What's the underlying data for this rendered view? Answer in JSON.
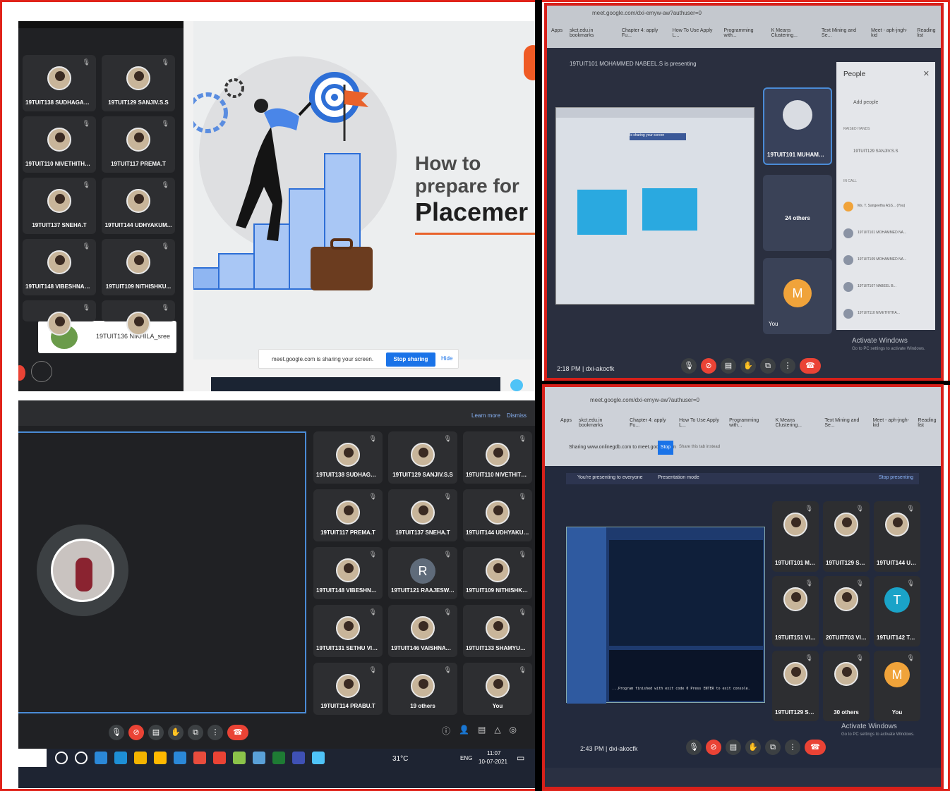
{
  "colors": {
    "border_red": "#e0231a",
    "meet_dark": "#202124",
    "tile": "#2d2e31",
    "accent_blue": "#1a73e8",
    "end_red": "#ea4335"
  },
  "panel1": {
    "tiles": [
      {
        "name": "19TUIT138 SUDHAGAR M"
      },
      {
        "name": "19TUIT129 SANJIV.S.S"
      },
      {
        "name": "19TUIT110 NIVETHITHA..."
      },
      {
        "name": "19TUIT117 PREMA.T"
      },
      {
        "name": "19TUIT137 SNEHA.T"
      },
      {
        "name": "19TUIT144 UDHYAKUM..."
      },
      {
        "name": "19TUIT148 VIBESHNAN.P"
      },
      {
        "name": "19TUIT109 NITHISHKU..."
      }
    ],
    "self_tile_name": "19TUIT136 NIKHILA_sree",
    "slide": {
      "title_line1": "How to",
      "title_line2": "prepare for",
      "title_line3": "Placemer"
    },
    "share_bar": {
      "text": "meet.google.com is sharing your screen.",
      "stop": "Stop sharing",
      "hide": "Hide"
    }
  },
  "panel2": {
    "url": "meet.google.com/dxi-emyw-aw?authuser=0",
    "bookmarks": [
      "Apps",
      "skct.edu.in bookmarks",
      "Chapter 4: apply Fu...",
      "How To Use Apply L...",
      "Programming with...",
      "K Means Clustering...",
      "Text Mining and Se...",
      "Meet - aph-jngh-kid",
      "Reading list"
    ],
    "presenting": "19TUIT101 MOHAMMED NABEEL.S is presenting",
    "speaker_tile": "19TUIT101 MUHAMMED NABEEL.S",
    "others_tile": "24 others",
    "you_tile": "You",
    "you_letter": "M",
    "people_title": "People",
    "add_people": "Add people",
    "raised_hands": "RAISED HANDS",
    "raised_name": "19TUIT129 SANJIV.S.S",
    "in_call": "IN CALL",
    "people_rows": [
      "Ms. T. Sangeetha ASS... (You)",
      "19TUIT101 MOHAMMED NA...",
      "19TUIT109 MOHAMMED NA...",
      "19TUIT107 NABEEL B...",
      "19TUIT110 NIVETHITHA..."
    ],
    "shared_tab": "Is sharing your screen",
    "activate_title": "Activate Windows",
    "activate_sub": "Go to PC settings to activate Windows.",
    "time_code": "2:18 PM | dxi-akocfk"
  },
  "panel3": {
    "top_links": [
      "Learn more",
      "Dismiss"
    ],
    "tiles": [
      {
        "name": "19TUIT138 SUDHAGAR M"
      },
      {
        "name": "19TUIT129 SANJIV.S.S"
      },
      {
        "name": "19TUIT110 NIVETHITHA..."
      },
      {
        "name": "19TUIT117 PREMA.T"
      },
      {
        "name": "19TUIT137 SNEHA.T"
      },
      {
        "name": "19TUIT144 UDHYAKUM..."
      },
      {
        "name": "19TUIT148 VIBESHNAN.P"
      },
      {
        "name": "19TUIT121 RAAJESWAR..."
      },
      {
        "name": "19TUIT109 NITHISHKU..."
      },
      {
        "name": "19TUIT131 SETHU VIGN..."
      },
      {
        "name": "19TUIT146 VAISHNAVI.S"
      },
      {
        "name": "19TUIT133 SHAMYUKT..."
      },
      {
        "name": "19TUIT114 PRABU.T"
      },
      {
        "name": "19 others"
      },
      {
        "name": "You"
      }
    ],
    "letter_avatar": "R",
    "tray": {
      "temp": "31°C",
      "lang": "ENG",
      "time": "11:07",
      "date": "10-07-2021"
    }
  },
  "panel4": {
    "url": "meet.google.com/dxi-emyw-aw?authuser=0",
    "bookmarks": [
      "Apps",
      "skct.edu.in bookmarks",
      "Chapter 4: apply Fu...",
      "How To Use Apply L...",
      "Programming with...",
      "K Means Clustering...",
      "Text Mining and Se...",
      "Meet - aph-jngh-kid",
      "Reading list"
    ],
    "sharing_text": "Sharing www.onlinegdb.com to meet.google.com",
    "stop": "Stop",
    "share_tab": "Share this tab instead",
    "presenting": "You're presenting to everyone",
    "stop_presenting": "Stop presenting",
    "presentation_mode": "Presentation mode",
    "tiles": [
      {
        "name": "19TUIT101 MUHAMME..."
      },
      {
        "name": "19TUIT129 SANJIV..."
      },
      {
        "name": "19TUIT144 UDHYAKUM..."
      },
      {
        "name": "19TUIT151 VIGNESHWA..."
      },
      {
        "name": "20TUIT703 VIGNESH M"
      },
      {
        "name": "19TUIT142 TARUN PRA..."
      },
      {
        "name": "19TUIT129 SUDHASHRI..."
      },
      {
        "name": "30 others"
      },
      {
        "name": "You"
      }
    ],
    "letter_T": "T",
    "letter_M": "M",
    "activate_title": "Activate Windows",
    "activate_sub": "Go to PC settings to activate Windows.",
    "time_code": "2:43 PM | dxi-akocfk",
    "code_output": "...Program finished with exit code 0 Press ENTER to exit console."
  }
}
